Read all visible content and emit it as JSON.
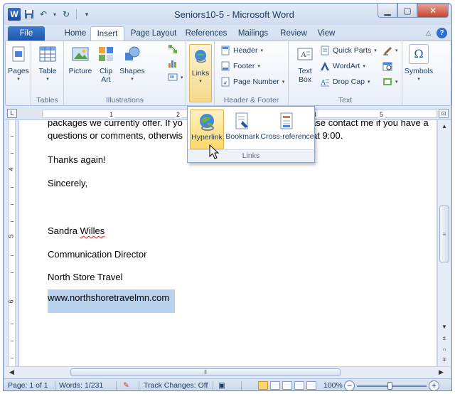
{
  "window": {
    "title": "Seniors10-5 - Microsoft Word",
    "app_icon": "W"
  },
  "tabs": [
    "File",
    "Home",
    "Insert",
    "Page Layout",
    "References",
    "Mailings",
    "Review",
    "View"
  ],
  "active_tab": "Insert",
  "ribbon": {
    "pages": {
      "label": "Pages"
    },
    "tables": {
      "table": "Table",
      "group": "Tables"
    },
    "illustrations": {
      "picture": "Picture",
      "clip_art_1": "Clip",
      "clip_art_2": "Art",
      "shapes": "Shapes",
      "group": "Illustrations"
    },
    "links": {
      "label": "Links"
    },
    "header_footer": {
      "header": "Header",
      "footer": "Footer",
      "page_number": "Page Number",
      "group": "Header & Footer"
    },
    "text": {
      "text_box_1": "Text",
      "text_box_2": "Box",
      "quick_parts": "Quick Parts",
      "wordart": "WordArt",
      "drop_cap": "Drop Cap",
      "group": "Text"
    },
    "symbols": {
      "label": "Symbols",
      "symbol_glyph": "Ω"
    }
  },
  "links_popup": {
    "hyperlink": "Hyperlink",
    "bookmark": "Bookmark",
    "cross_reference": "Cross-reference",
    "group": "Links"
  },
  "ruler": {
    "corner": "L",
    "numbers": [
      "1",
      "2",
      "4",
      "5"
    ],
    "v_numbers": [
      "4",
      "5",
      "6"
    ]
  },
  "document": {
    "line_partial_left": "packages we currently offer.  If yo",
    "line_partial_right": "lease contact me if you have a",
    "line2_left": "questions or comments, otherwis",
    "line2_right": "at 9:00.",
    "thanks": "Thanks again!",
    "sincerely": "Sincerely,",
    "sign_first": "Sandra",
    "sign_last": "Willes",
    "role": "Communication Director",
    "company": "North Store Travel",
    "website": "www.northshoretravelmn.com"
  },
  "statusbar": {
    "page": "Page: 1 of 1",
    "words": "Words: 1/231",
    "track_changes": "Track Changes: Off",
    "zoom": "100%"
  },
  "colors": {
    "accent": "#2b579a",
    "file_tab": "#1f56a8",
    "selection": "#b8d2ee",
    "highlight": "#ffd869"
  }
}
